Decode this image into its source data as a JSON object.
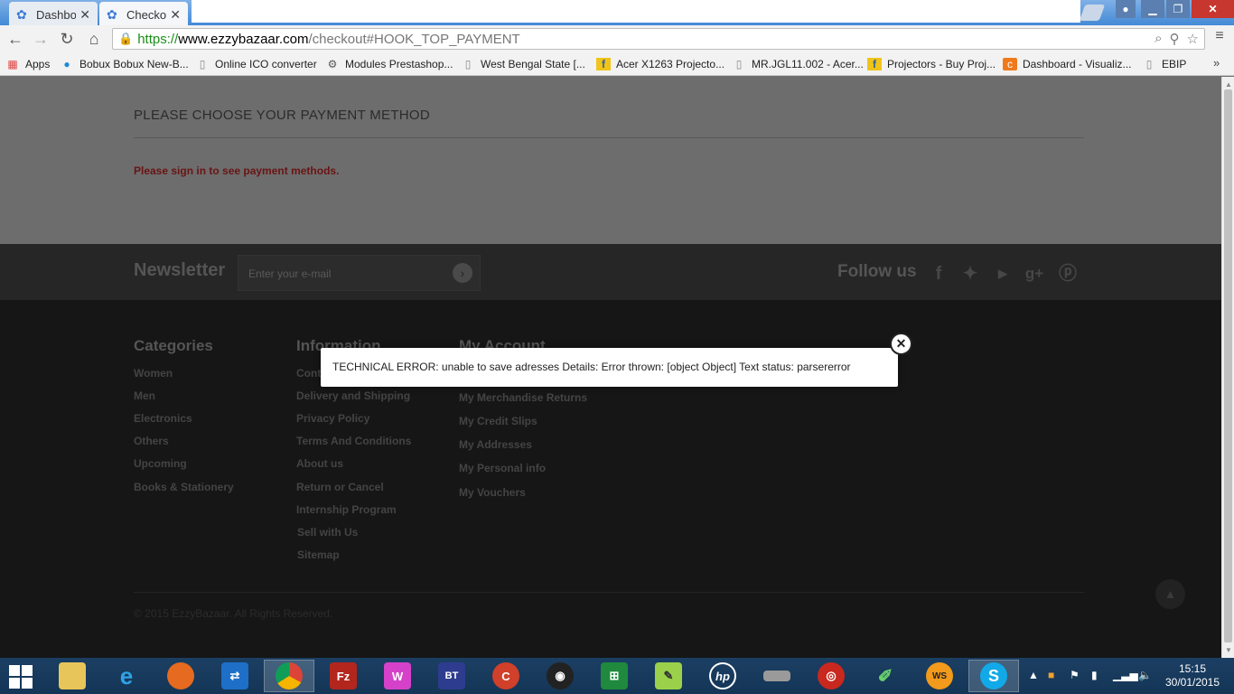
{
  "browser": {
    "tabs": [
      {
        "title": "Dashbo",
        "active": false
      },
      {
        "title": "Checko",
        "active": true
      }
    ],
    "tab_close": "✕",
    "url": {
      "scheme": "https://",
      "host": "www.ezzybazaar.com",
      "path": "/checkout#HOOK_TOP_PAYMENT"
    },
    "bookmarks": [
      {
        "label": "Apps",
        "icon": "apps-icon"
      },
      {
        "label": "Bobux Bobux New-B...",
        "icon": "bobux-icon"
      },
      {
        "label": "Online ICO converter",
        "icon": "page-icon"
      },
      {
        "label": "Modules Prestashop...",
        "icon": "prestashop-icon"
      },
      {
        "label": "West Bengal State [...",
        "icon": "page-icon"
      },
      {
        "label": "Acer X1263 Projecto...",
        "icon": "flipkart-icon"
      },
      {
        "label": "MR.JGL11.002 - Acer...",
        "icon": "page-icon"
      },
      {
        "label": "Projectors - Buy Proj...",
        "icon": "flipkart-icon"
      },
      {
        "label": "Dashboard - Visualiz...",
        "icon": "dashboard-icon"
      },
      {
        "label": "EBIP",
        "icon": "page-icon"
      }
    ],
    "bookmarks_more": "»"
  },
  "payment": {
    "title": "PLEASE CHOOSE YOUR PAYMENT METHOD",
    "message": "Please sign in to see payment methods."
  },
  "newsletter": {
    "title": "Newsletter",
    "placeholder": "Enter your e-mail",
    "follow_title": "Follow us"
  },
  "footer": {
    "categories": {
      "title": "Categories",
      "links": [
        "Women",
        "Men",
        "Electronics",
        "Others",
        "Upcoming",
        "Books & Stationery"
      ]
    },
    "information": {
      "title": "Information",
      "links": [
        "Cont",
        "Delivery and Shipping",
        "Privacy Policy",
        "Terms And Conditions",
        "About us",
        "Return or Cancel",
        "Internship Program",
        "Sell with Us",
        "Sitemap"
      ]
    },
    "account": {
      "title": "My Account",
      "links": [
        "My Merchandise Returns",
        "My Credit Slips",
        "My Addresses",
        "My Personal info",
        "My Vouchers"
      ]
    },
    "copyright": "© 2015 EzzyBazaar. All Rights Reserved."
  },
  "modal": {
    "message": "TECHNICAL ERROR: unable to save adresses Details: Error thrown: [object Object] Text status: parsererror"
  },
  "taskbar": {
    "apps": [
      "file-explorer",
      "internet-explorer",
      "firefox",
      "teamviewer",
      "chrome",
      "filezilla",
      "wamp",
      "bittorrent",
      "ccleaner",
      "camera-app",
      "excel",
      "notepad-plus-plus",
      "hp",
      "scanner",
      "firewall",
      "marker",
      "webstorm",
      "skype"
    ],
    "time": "15:15",
    "date": "30/01/2015"
  },
  "colors": {
    "overlay_page": "#6d6d6d",
    "error_text": "#6a1414",
    "footer_bg": "#161616",
    "newsletter_bg": "#262626",
    "taskbar_bg": "#1b3f63"
  }
}
